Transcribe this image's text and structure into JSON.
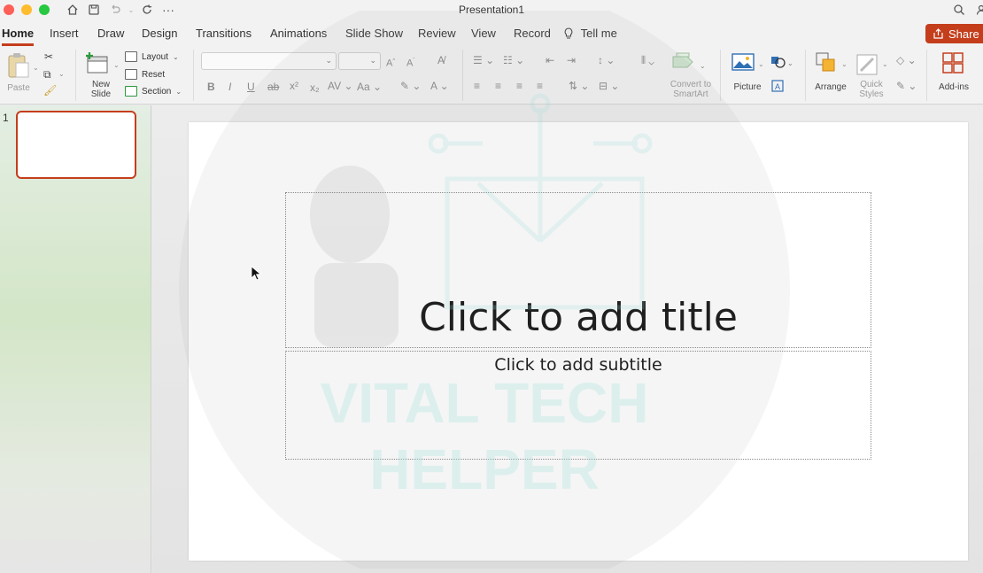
{
  "window": {
    "title": "Presentation1"
  },
  "quick_access": [
    "home-icon",
    "save-icon",
    "undo-icon",
    "redo-icon",
    "more-icon"
  ],
  "tabs": [
    {
      "label": "Home",
      "active": true
    },
    {
      "label": "Insert"
    },
    {
      "label": "Draw"
    },
    {
      "label": "Design"
    },
    {
      "label": "Transitions"
    },
    {
      "label": "Animations"
    },
    {
      "label": "Slide Show"
    },
    {
      "label": "Review"
    },
    {
      "label": "View"
    },
    {
      "label": "Record"
    },
    {
      "label": "Tell me"
    }
  ],
  "share_label": "Share",
  "ribbon": {
    "paste": "Paste",
    "new_slide": "New\nSlide",
    "layout": "Layout",
    "reset": "Reset",
    "section": "Section",
    "convert_smartart": "Convert to\nSmartArt",
    "picture": "Picture",
    "arrange": "Arrange",
    "quick_styles": "Quick\nStyles",
    "add_ins": "Add-ins"
  },
  "thumbnails": {
    "slide_number": "1"
  },
  "slide": {
    "title_placeholder": "Click to add title",
    "subtitle_placeholder": "Click to add subtitle"
  },
  "watermark": {
    "line1": "VITAL TECH",
    "line2": "HELPER"
  },
  "colors": {
    "accent": "#c43e1c",
    "ribbon_bg": "#f3f2f2",
    "thumb_panel": "#d3e6c7"
  }
}
